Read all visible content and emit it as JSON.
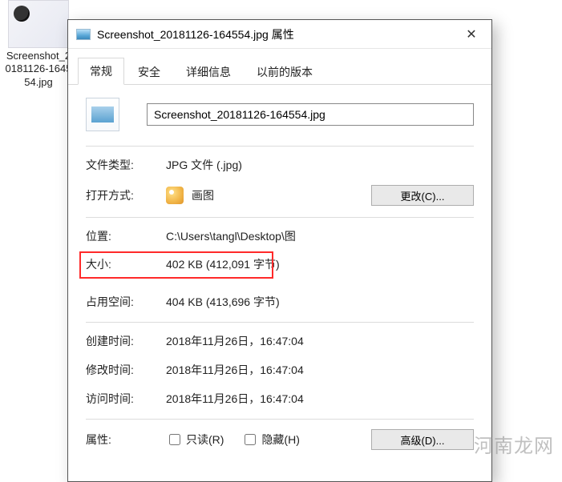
{
  "desktop": {
    "thumb_caption": "Screenshot_20181126-164554.jpg"
  },
  "dialog": {
    "title": "Screenshot_20181126-164554.jpg 属性",
    "close_glyph": "✕"
  },
  "tabs": {
    "general": "常规",
    "security": "安全",
    "details": "详细信息",
    "previous": "以前的版本"
  },
  "file": {
    "name_value": "Screenshot_20181126-164554.jpg"
  },
  "labels": {
    "filetype": "文件类型:",
    "openwith": "打开方式:",
    "location": "位置:",
    "size": "大小:",
    "size_on_disk": "占用空间:",
    "created": "创建时间:",
    "modified": "修改时间:",
    "accessed": "访问时间:",
    "attributes": "属性:"
  },
  "values": {
    "filetype": "JPG 文件 (.jpg)",
    "openwith_app": "画图",
    "change_btn": "更改(C)...",
    "location": "C:\\Users\\tangl\\Desktop\\图",
    "size": "402 KB (412,091 字节)",
    "size_on_disk": "404 KB (413,696 字节)",
    "created": "2018年11月26日，16:47:04",
    "modified": "2018年11月26日，16:47:04",
    "accessed": "2018年11月26日，16:47:04",
    "readonly": "只读(R)",
    "hidden": "隐藏(H)",
    "advanced_btn": "高级(D)..."
  },
  "watermark": "河南龙网"
}
